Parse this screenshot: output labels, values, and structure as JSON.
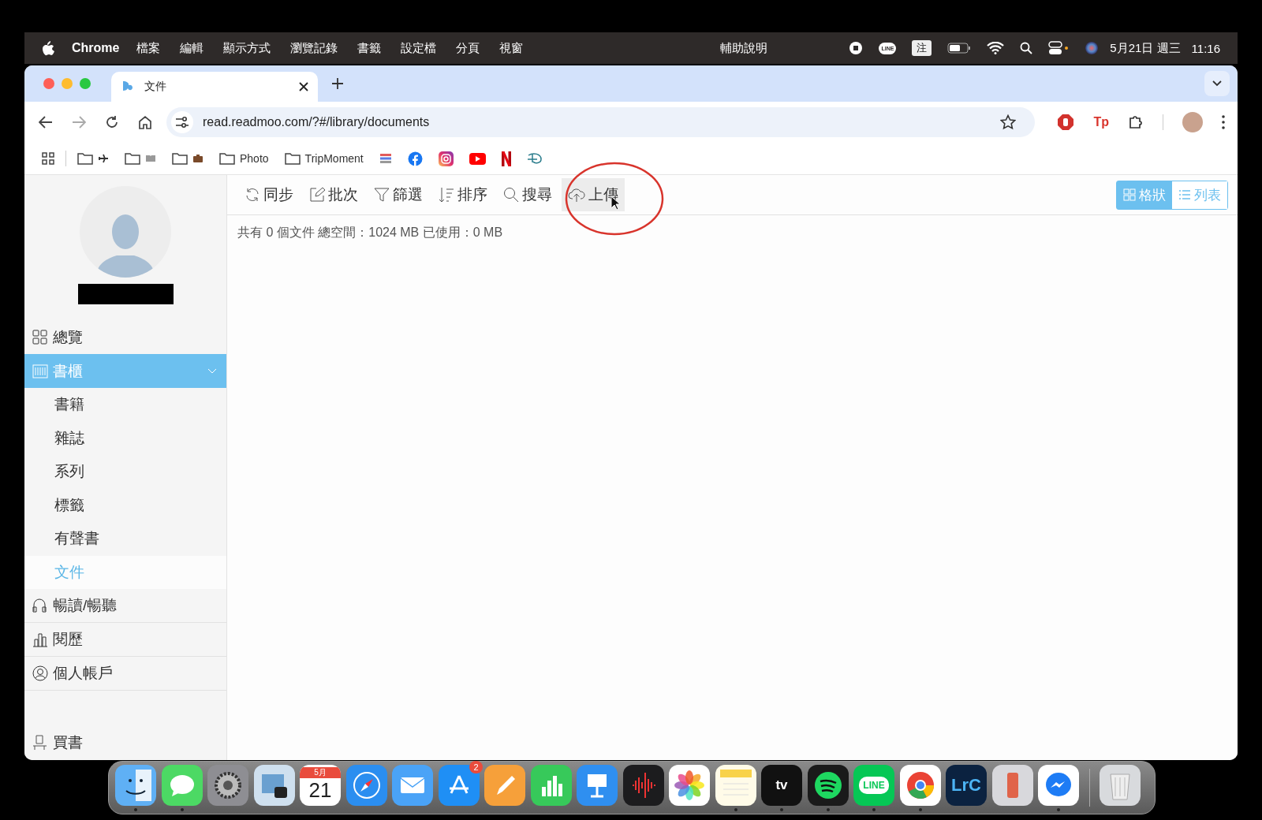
{
  "menu_bar": {
    "app": "Chrome",
    "menus": [
      "檔案",
      "編輯",
      "顯示方式",
      "瀏覽記錄",
      "書籤",
      "設定檔",
      "分頁",
      "視窗"
    ],
    "help": "輔助說明",
    "line_label": "LINE",
    "ime": "注",
    "date": "5月21日 週三",
    "time": "11:16"
  },
  "browser": {
    "tab": {
      "title": "文件"
    },
    "url": "read.readmoo.com/?#/library/documents",
    "extension_label": "Tp",
    "bookmarks": [
      {
        "kind": "folder-plane"
      },
      {
        "kind": "folder-book"
      },
      {
        "kind": "folder-bag"
      },
      {
        "kind": "folder",
        "label": "Photo"
      },
      {
        "kind": "folder",
        "label": "TripMoment"
      },
      {
        "kind": "stripes"
      },
      {
        "kind": "facebook"
      },
      {
        "kind": "instagram"
      },
      {
        "kind": "youtube"
      },
      {
        "kind": "netflix"
      },
      {
        "kind": "disney"
      }
    ]
  },
  "sidebar": {
    "items": [
      {
        "label": "總覽",
        "kind": "grid",
        "selected": false
      },
      {
        "label": "書櫃",
        "kind": "shelf",
        "selected": true,
        "expanded": true,
        "children": [
          {
            "label": "書籍",
            "selected": false
          },
          {
            "label": "雜誌",
            "selected": false
          },
          {
            "label": "系列",
            "selected": false
          },
          {
            "label": "標籤",
            "selected": false
          },
          {
            "label": "有聲書",
            "selected": false
          },
          {
            "label": "文件",
            "selected": true
          }
        ]
      },
      {
        "label": "暢讀/暢聽",
        "kind": "read",
        "selected": false
      },
      {
        "label": "閱歷",
        "kind": "bars",
        "selected": false
      },
      {
        "label": "個人帳戶",
        "kind": "user",
        "selected": false
      }
    ],
    "footer": {
      "label": "買書"
    }
  },
  "toolbar": {
    "buttons": [
      {
        "kind": "sync",
        "label": "同步",
        "hovered": false
      },
      {
        "kind": "edit",
        "label": "批次",
        "hovered": false
      },
      {
        "kind": "filter",
        "label": "篩選",
        "hovered": false
      },
      {
        "kind": "sort",
        "label": "排序",
        "hovered": false
      },
      {
        "kind": "search",
        "label": "搜尋",
        "hovered": false
      },
      {
        "kind": "upload",
        "label": "上傳",
        "hovered": true
      }
    ],
    "views": [
      {
        "kind": "grid",
        "label": "格狀",
        "selected": true
      },
      {
        "kind": "list",
        "label": "列表",
        "selected": false
      }
    ]
  },
  "summary": "共有 0 個文件 總空間：1024 MB 已使用：0 MB",
  "dock": [
    {
      "kind": "finder",
      "running": true
    },
    {
      "kind": "messages",
      "running": true
    },
    {
      "kind": "settings",
      "running": false
    },
    {
      "kind": "preview",
      "running": false
    },
    {
      "kind": "calendar",
      "month": "5月",
      "day": "21",
      "running": false
    },
    {
      "kind": "safari",
      "running": false
    },
    {
      "kind": "mail",
      "running": false
    },
    {
      "kind": "appstore",
      "badge": "2",
      "running": false
    },
    {
      "kind": "pages",
      "running": false
    },
    {
      "kind": "numbers",
      "running": false
    },
    {
      "kind": "keynote",
      "running": false
    },
    {
      "kind": "voice",
      "running": false
    },
    {
      "kind": "photos",
      "running": false
    },
    {
      "kind": "notes",
      "running": true
    },
    {
      "kind": "tv",
      "label": "tv",
      "running": true
    },
    {
      "kind": "spotify",
      "running": true
    },
    {
      "kind": "line",
      "label": "LINE",
      "running": true
    },
    {
      "kind": "chrome",
      "running": true
    },
    {
      "kind": "lightroom",
      "label": "LrC",
      "running": false
    },
    {
      "kind": "phone",
      "running": false
    },
    {
      "kind": "messenger",
      "running": true
    },
    {
      "kind": "trash",
      "running": false
    }
  ]
}
